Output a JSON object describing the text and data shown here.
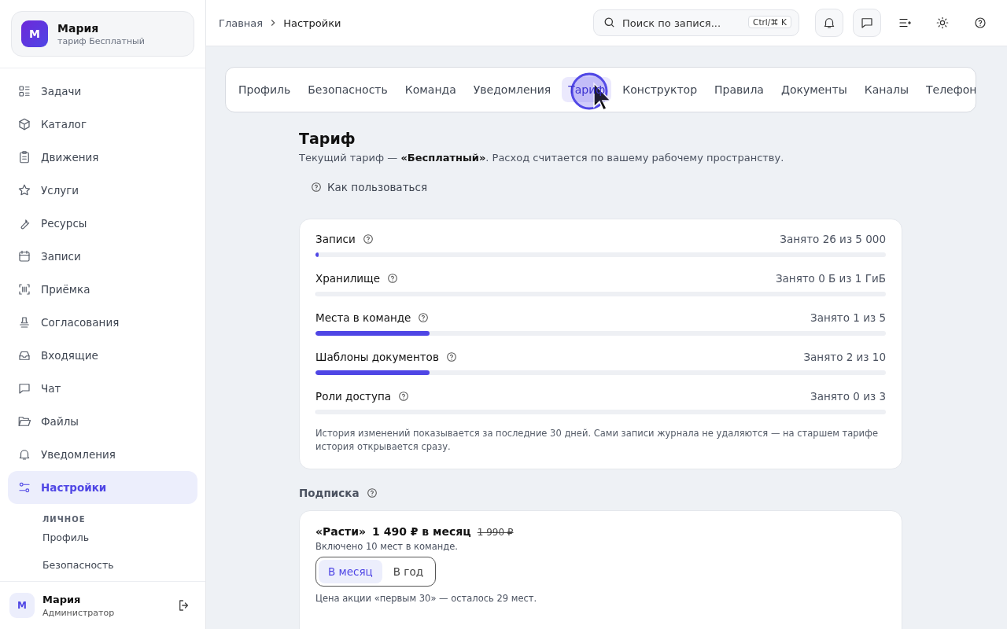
{
  "account": {
    "avatar": "М",
    "name": "Мария",
    "plan": "тариф Бесплатный"
  },
  "nav": [
    {
      "label": "Задачи",
      "selected": false
    },
    {
      "label": "Каталог",
      "selected": false
    },
    {
      "label": "Движения",
      "selected": false
    },
    {
      "label": "Услуги",
      "selected": false
    },
    {
      "label": "Ресурсы",
      "selected": false
    },
    {
      "label": "Записи",
      "selected": false
    },
    {
      "label": "Приёмка",
      "selected": false
    },
    {
      "label": "Согласования",
      "selected": false
    },
    {
      "label": "Входящие",
      "selected": false
    },
    {
      "label": "Чат",
      "selected": false
    },
    {
      "label": "Файлы",
      "selected": false
    },
    {
      "label": "Уведомления",
      "selected": false
    },
    {
      "label": "Настройки",
      "selected": true
    }
  ],
  "subnav": {
    "heading": "ЛИЧНОЕ",
    "items": [
      {
        "label": "Профиль",
        "selected": false
      },
      {
        "label": "Безопасность",
        "selected": false
      }
    ]
  },
  "user": {
    "avatar": "М",
    "name": "Мария",
    "role": "Администратор"
  },
  "breadcrumbs": [
    "Главная",
    "Настройки"
  ],
  "search": {
    "placeholder": "Поиск по запися...",
    "shortcut": "Ctrl/⌘ K"
  },
  "tabs": [
    {
      "label": "Профиль",
      "selected": false
    },
    {
      "label": "Безопасность",
      "selected": false
    },
    {
      "label": "Команда",
      "selected": false
    },
    {
      "label": "Уведомления",
      "selected": false
    },
    {
      "label": "Тариф",
      "selected": true
    },
    {
      "label": "Конструктор",
      "selected": false
    },
    {
      "label": "Правила",
      "selected": false
    },
    {
      "label": "Документы",
      "selected": false
    },
    {
      "label": "Каналы",
      "selected": false
    },
    {
      "label": "Телефон",
      "selected": false
    }
  ],
  "page": {
    "title": "Тариф",
    "description": "Текущий тариф — **«Бесплатный»**. Расход считается по вашему рабочему пространству.",
    "help_link": "Как пользоваться"
  },
  "usage": [
    {
      "name": "Записи",
      "reading": "Занято 26 из 5 000",
      "level": 0.005
    },
    {
      "name": "Хранилище",
      "reading": "Занято 0 Б из 1 ГиБ",
      "level": 0
    },
    {
      "name": "Места в команде",
      "reading": "Занято 1 из 5",
      "level": 0.2
    },
    {
      "name": "Шаблоны документов",
      "reading": "Занято 2 из 10",
      "level": 0.2
    },
    {
      "name": "Роли доступа",
      "reading": "Занято 0 из 3",
      "level": 0
    }
  ],
  "usage_note": "История изменений показывается за последние 30 дней. Сами записи журнала не удаляются — на старшем тарифе история открывается сразу.",
  "subscription": {
    "heading": "Подписка",
    "plan": "«Расти»",
    "price": "1 490 ₽ в месяц",
    "old_price": "1 990 ₽",
    "included": "Включено 10 мест в команде.",
    "periods": [
      {
        "label": "В месяц",
        "selected": true
      },
      {
        "label": "В год",
        "selected": false
      }
    ],
    "promo": "Цена акции «первым 30» — осталось 29 мест."
  }
}
